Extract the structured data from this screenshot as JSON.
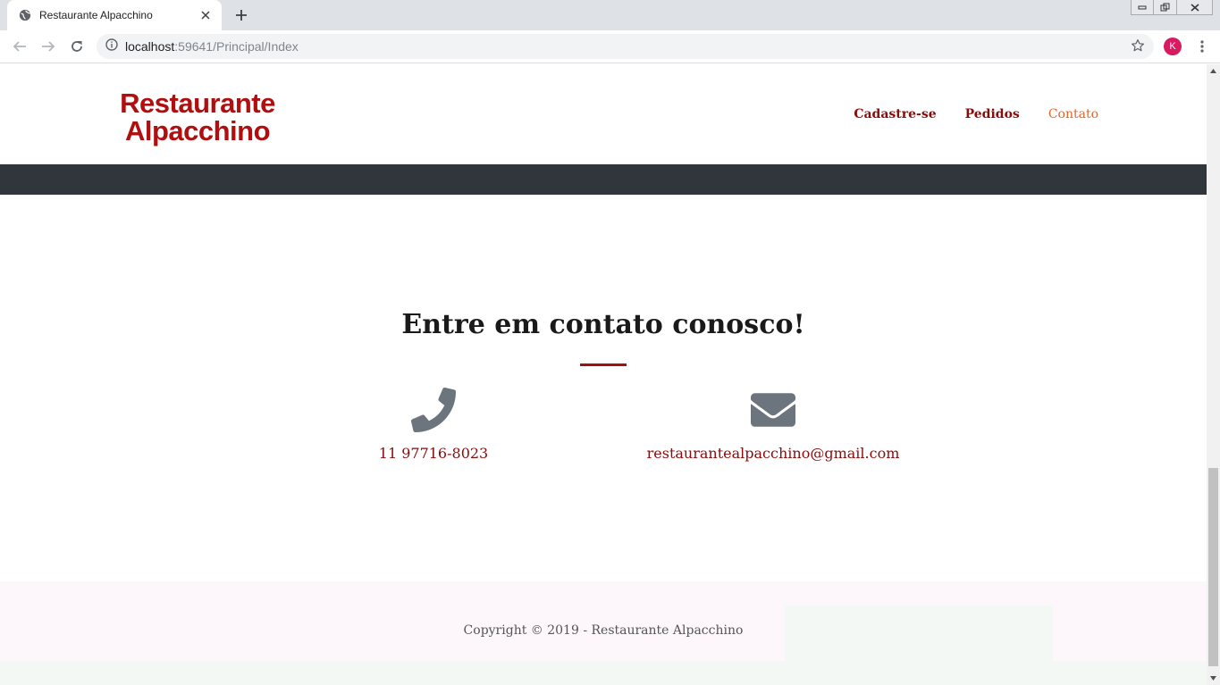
{
  "browser": {
    "tab_title": "Restaurante Alpacchino",
    "url_host": "localhost",
    "url_path": ":59641/Principal/Index",
    "profile_initial": "K"
  },
  "site": {
    "logo_line1": "Restaurante",
    "logo_line2": "Alpacchino",
    "nav": {
      "signup": "Cadastre-se",
      "orders": "Pedidos",
      "contact": "Contato"
    }
  },
  "contact": {
    "title": "Entre em contato conosco!",
    "phone": "11 97716-8023",
    "email": "restaurantealpacchino@gmail.com"
  },
  "footer": {
    "copyright": "Copyright © 2019 - Restaurante Alpacchino"
  },
  "colors": {
    "brand_red": "#b10f0f",
    "nav_red": "#8b0a0a",
    "nav_active": "#e0662a",
    "dark_band": "#31363c",
    "icon_gray": "#6c757d"
  }
}
